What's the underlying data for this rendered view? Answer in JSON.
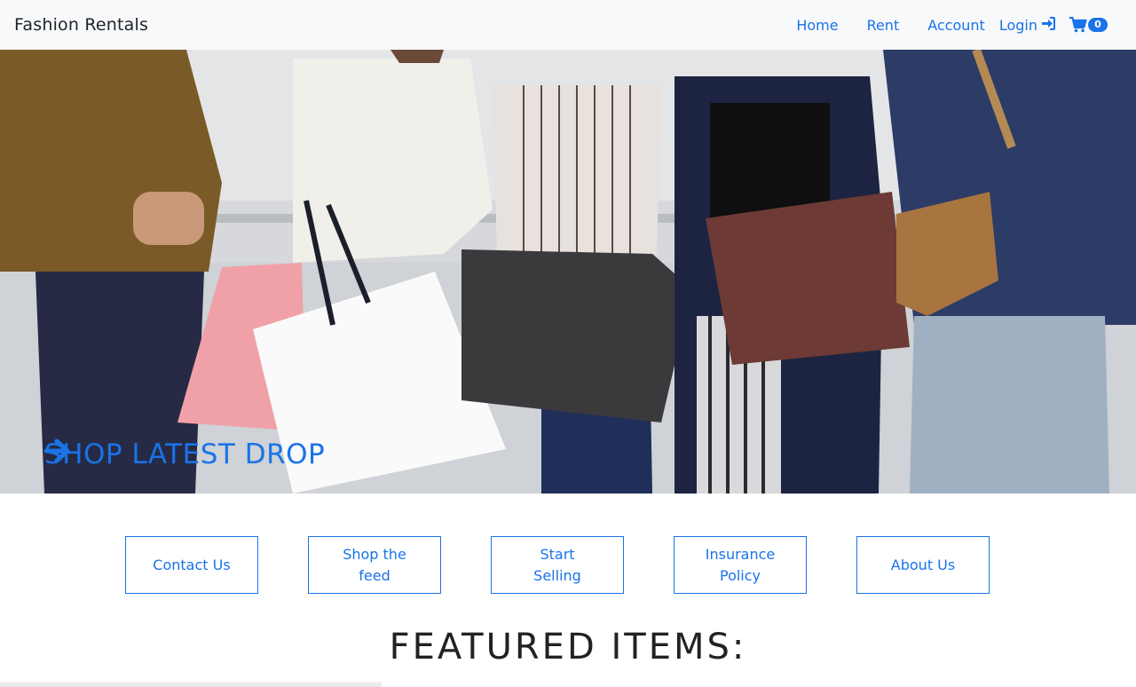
{
  "navbar": {
    "brand": "Fashion Rentals",
    "links": [
      {
        "label": "Home"
      },
      {
        "label": "Rent"
      },
      {
        "label": "Account"
      }
    ],
    "login_label": "Login",
    "login_icon": "sign-in-icon",
    "cart_icon": "shopping-cart-icon",
    "cart_count": "0"
  },
  "hero": {
    "cta_label": "SHOP LATEST DROP",
    "cta_icon": "arrow-right-icon",
    "image": "people-holding-shopping-bags"
  },
  "quick_links": [
    {
      "label": "Contact Us"
    },
    {
      "label": "Shop the feed"
    },
    {
      "label": "Start Selling"
    },
    {
      "label": "Insurance Policy"
    },
    {
      "label": "About Us"
    }
  ],
  "featured": {
    "title": "FEATURED ITEMS:"
  },
  "colors": {
    "accent": "#1a73e8",
    "navbar_bg": "#f8f9fa"
  }
}
